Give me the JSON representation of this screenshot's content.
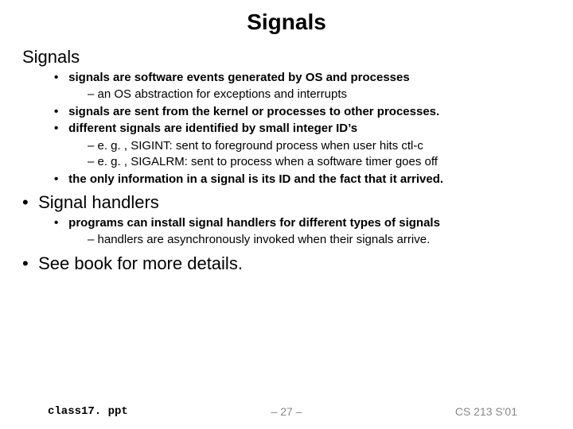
{
  "title": "Signals",
  "sections": [
    {
      "heading": "Signals",
      "bullets": [
        {
          "text": "signals are software events generated by OS and processes",
          "sub": [
            "– an OS abstraction for exceptions and interrupts"
          ]
        },
        {
          "text": "signals are sent from the kernel or processes to other processes.",
          "sub": []
        },
        {
          "text": "different signals are identified by small integer ID’s",
          "sub": [
            "– e. g. , SIGINT: sent to foreground process when user hits ctl-c",
            "– e. g. , SIGALRM: sent to process when a software timer goes off"
          ]
        },
        {
          "text": "the only information in a signal is its ID and the fact that it arrived.",
          "sub": []
        }
      ]
    },
    {
      "heading": "Signal handlers",
      "bullets": [
        {
          "text": "programs can install signal handlers for different types of signals",
          "sub": [
            "– handlers are asynchronously invoked when their signals arrive."
          ]
        }
      ]
    },
    {
      "heading": "See book for more details.",
      "bullets": []
    }
  ],
  "footer": {
    "filename": "class17. ppt",
    "page": "– 27 –",
    "course": "CS 213 S'01"
  }
}
